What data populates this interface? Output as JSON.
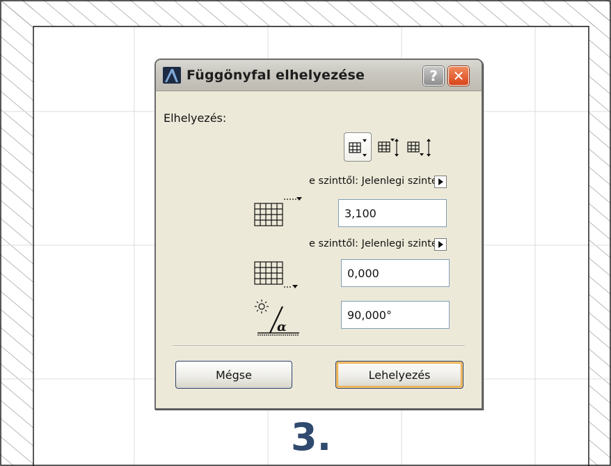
{
  "dialog": {
    "title": "Függönyfal elhelyezése",
    "help_symbol": "?",
    "close_symbol": "✕",
    "placement_label": "Elhelyezés:",
    "level_rows": [
      {
        "label": "e szinttől: Jelenlegi szinten"
      },
      {
        "label": "e szinttől: Jelenlegi szinten"
      }
    ],
    "top_height_value": "3,100",
    "bottom_offset_value": "0,000",
    "angle_value": "90,000°",
    "cancel_label": "Mégse",
    "place_label": "Lehelyezés"
  },
  "overlay": {
    "step_number": "3."
  },
  "colors": {
    "title_close_red": "#d9441a",
    "default_button_glow": "#f5c26a",
    "step_number_blue": "#2f4a6e",
    "hatch": "#7a7a7a"
  }
}
